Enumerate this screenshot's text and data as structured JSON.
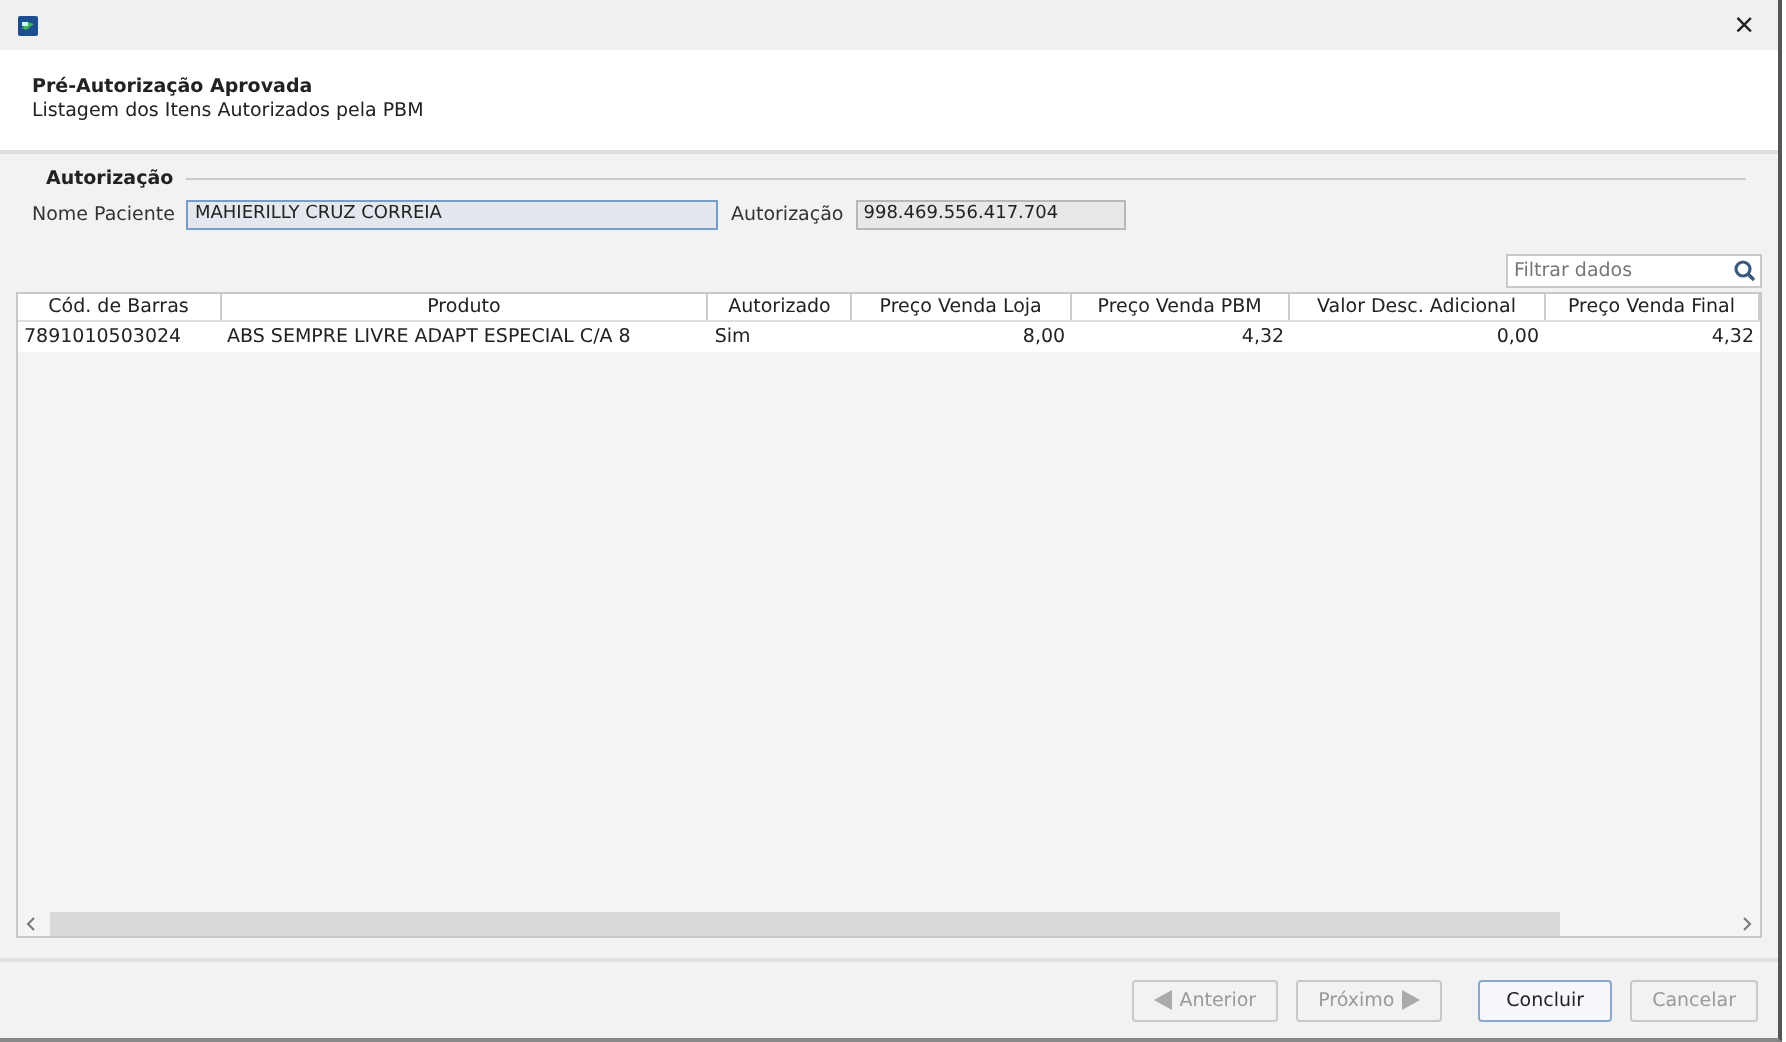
{
  "window": {
    "close": "×"
  },
  "header": {
    "title": "Pré-Autorização Aprovada",
    "subtitle": "Listagem dos Itens Autorizados pela PBM"
  },
  "group": {
    "title": "Autorização",
    "fields": [
      {
        "label": "Nome Paciente",
        "value": "MAHIERILLY CRUZ CORREIA",
        "focused": true
      },
      {
        "label": "Autorização",
        "value": "998.469.556.417.704",
        "focused": false
      }
    ]
  },
  "search": {
    "placeholder": "Filtrar dados"
  },
  "table": {
    "columns": [
      {
        "label": "Cód. de Barras"
      },
      {
        "label": "Produto"
      },
      {
        "label": "Autorizado"
      },
      {
        "label": "Preço Venda Loja"
      },
      {
        "label": "Preço Venda PBM"
      },
      {
        "label": "Valor Desc. Adicional"
      },
      {
        "label": "Preço Venda Final"
      }
    ],
    "rows": [
      [
        "7891010503024",
        "ABS SEMPRE LIVRE ADAPT ESPECIAL C/A 8",
        "Sim",
        "8,00",
        "4,32",
        "0,00",
        "4,32"
      ]
    ]
  },
  "buttons": [
    {
      "label": "Anterior",
      "kind": "prev",
      "disabled": true,
      "focused": false
    },
    {
      "label": "Próximo",
      "kind": "next",
      "disabled": true,
      "focused": false
    },
    {
      "label": "Concluir",
      "kind": "plain",
      "disabled": false,
      "focused": true
    },
    {
      "label": "Cancelar",
      "kind": "plain",
      "disabled": true,
      "focused": false
    }
  ]
}
